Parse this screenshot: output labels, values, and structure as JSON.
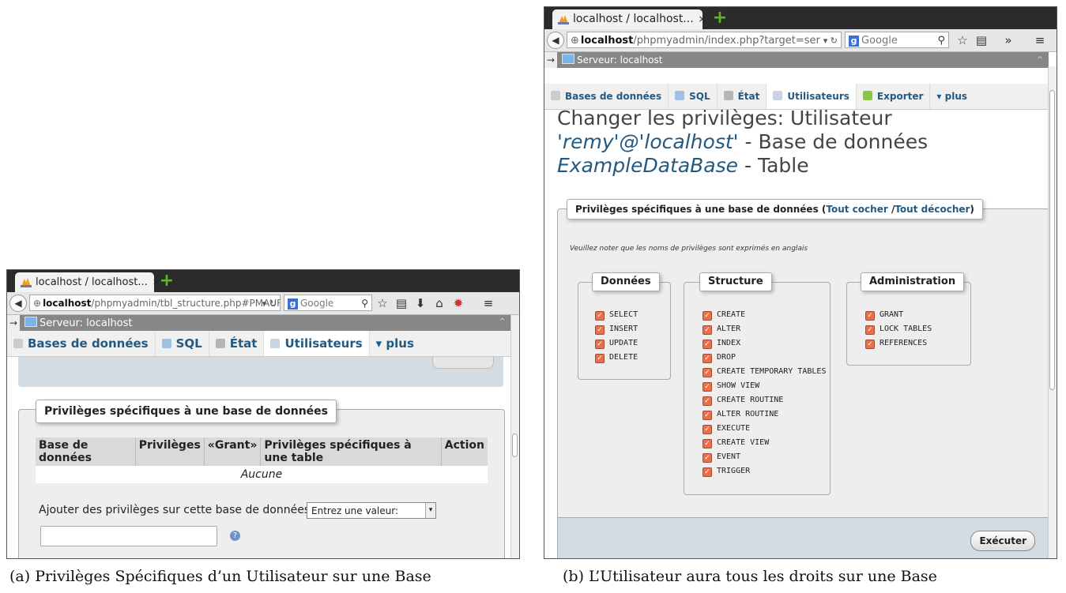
{
  "colors": {
    "link": "#235a81",
    "checkbox": "#e8704a",
    "server_bar": "#878787",
    "tab_bar": "#2b2b2b"
  },
  "window_a": {
    "tab_title": "localhost / localhost...",
    "tab_close": "×",
    "url_host": "localhost",
    "url_rest": "/phpmyadmin/tbl_structure.php#PMAUR",
    "search_placeholder": "Google",
    "server_label": "Serveur: localhost",
    "tabs": [
      {
        "label": "Bases de données",
        "icon": "database-icon"
      },
      {
        "label": "SQL",
        "icon": "sql-icon"
      },
      {
        "label": "État",
        "icon": "status-icon"
      },
      {
        "label": "Utilisateurs",
        "icon": "users-icon"
      },
      {
        "label": "plus",
        "icon": "dropdown-icon"
      }
    ],
    "fieldset_legend": "Privilèges spécifiques à une base de données",
    "table_headers": [
      "Base de données",
      "Privilèges",
      "«Grant»",
      "Privilèges spécifiques à une table",
      "Action"
    ],
    "empty_row": "Aucune",
    "add_label": "Ajouter des privilèges sur cette base de données:",
    "select_value": "Entrez une valeur:",
    "text_input_value": ""
  },
  "window_b": {
    "tab_title": "localhost / localhost...",
    "tab_close": "×",
    "url_host": "localhost",
    "url_rest": "/phpmyadmin/index.php?target=ser",
    "search_placeholder": "Google",
    "server_label": "Serveur: localhost",
    "tabs": [
      {
        "label": "Bases de données",
        "icon": "database-icon"
      },
      {
        "label": "SQL",
        "icon": "sql-icon"
      },
      {
        "label": "État",
        "icon": "status-icon"
      },
      {
        "label": "Utilisateurs",
        "icon": "users-icon"
      },
      {
        "label": "Exporter",
        "icon": "export-icon"
      },
      {
        "label": "plus",
        "icon": "dropdown-icon"
      }
    ],
    "heading_prefix": "Changer les privilèges: Utilisateur",
    "heading_user": "'remy'@'localhost'",
    "heading_mid": " - Base de données",
    "heading_db": "ExampleDataBase",
    "heading_suffix": " - Table",
    "fieldset_legend_prefix": "Privilèges spécifiques à une base de données (",
    "check_all": "Tout cocher",
    "legend_sep": " /",
    "uncheck_all": "Tout décocher",
    "legend_suffix": ")",
    "note": "Veuillez noter que les noms de privilèges sont exprimés en anglais",
    "groups": {
      "data": {
        "title": "Données",
        "items": [
          "SELECT",
          "INSERT",
          "UPDATE",
          "DELETE"
        ]
      },
      "structure": {
        "title": "Structure",
        "items": [
          "CREATE",
          "ALTER",
          "INDEX",
          "DROP",
          "CREATE TEMPORARY TABLES",
          "SHOW VIEW",
          "CREATE ROUTINE",
          "ALTER ROUTINE",
          "EXECUTE",
          "CREATE VIEW",
          "EVENT",
          "TRIGGER"
        ]
      },
      "admin": {
        "title": "Administration",
        "items": [
          "GRANT",
          "LOCK TABLES",
          "REFERENCES"
        ]
      }
    },
    "submit_label": "Exécuter"
  },
  "captions": {
    "a": "(a) Privilèges Spécifiques d’un Utilisateur sur une Base",
    "b": "(b) L’Utilisateur aura tous les droits sur une Base"
  }
}
